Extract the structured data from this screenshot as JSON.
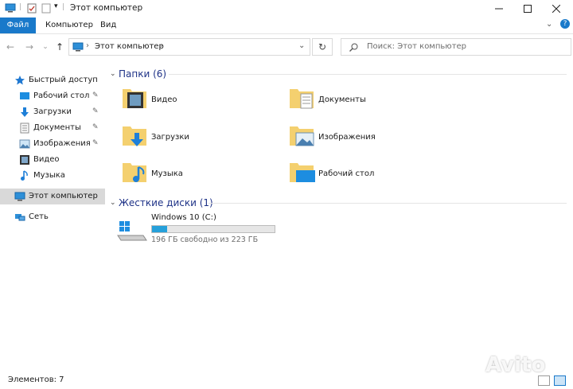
{
  "window": {
    "title": "Этот компьютер"
  },
  "ribbon": {
    "tabs": [
      "Файл",
      "Компьютер",
      "Вид"
    ]
  },
  "address": {
    "path": "Этот компьютер",
    "separator": "›"
  },
  "search": {
    "placeholder": "Поиск: Этот компьютер"
  },
  "sidebar": {
    "quick_access": "Быстрый доступ",
    "items": [
      {
        "label": "Рабочий стол",
        "icon": "desktop-icon",
        "pinned": true
      },
      {
        "label": "Загрузки",
        "icon": "download-icon",
        "pinned": true
      },
      {
        "label": "Документы",
        "icon": "documents-icon",
        "pinned": true
      },
      {
        "label": "Изображения",
        "icon": "pictures-icon",
        "pinned": true
      },
      {
        "label": "Видео",
        "icon": "video-icon",
        "pinned": false
      },
      {
        "label": "Музыка",
        "icon": "music-icon",
        "pinned": false
      }
    ],
    "this_pc": "Этот компьютер",
    "network": "Сеть"
  },
  "folders_section": {
    "title": "Папки (6)",
    "items": [
      {
        "label": "Видео",
        "icon": "video-folder-icon"
      },
      {
        "label": "Документы",
        "icon": "documents-folder-icon"
      },
      {
        "label": "Загрузки",
        "icon": "downloads-folder-icon"
      },
      {
        "label": "Изображения",
        "icon": "pictures-folder-icon"
      },
      {
        "label": "Музыка",
        "icon": "music-folder-icon"
      },
      {
        "label": "Рабочий стол",
        "icon": "desktop-folder-icon"
      }
    ]
  },
  "drives_section": {
    "title": "Жесткие диски (1)",
    "drive": {
      "name": "Windows 10 (C:)",
      "free_text": "196 ГБ свободно из 223 ГБ",
      "used_fraction": 0.121
    }
  },
  "status": {
    "items": "Элементов: 7"
  },
  "watermark": "Avito",
  "colors": {
    "accent": "#1979ca",
    "header_text": "#1e3287",
    "progress": "#26a0da",
    "folder": "#f4d06f"
  }
}
